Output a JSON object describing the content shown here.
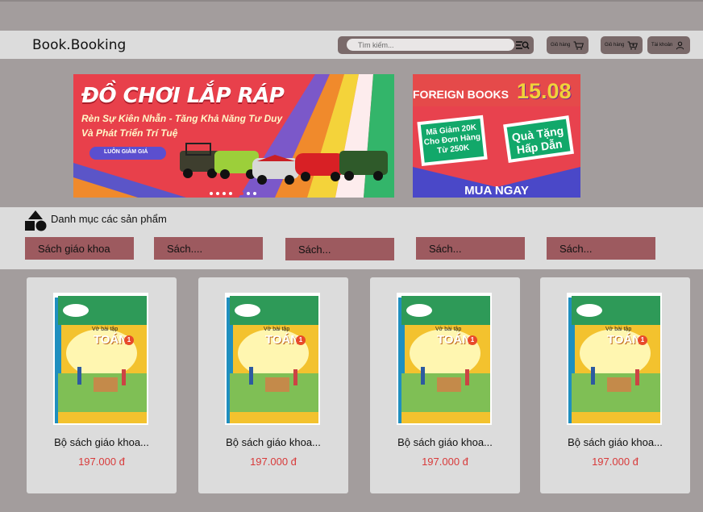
{
  "header": {
    "brand": "Book.Booking",
    "search_placeholder": "Tìm kiếm...",
    "orders_label_1": "Giỏ hàng",
    "orders_label_2": "Giỏ hàng",
    "account_label": "Tài khoản"
  },
  "banners": {
    "main": {
      "headline": "ĐỒ CHƠI LẮP RÁP",
      "line1": "Rèn Sự Kiên Nhẫn - Tăng Khả Năng Tư Duy",
      "line2": "Và Phát Triển Trí Tuệ",
      "badge": "LUÔN GIẢM GIÁ"
    },
    "side": {
      "title": "FOREIGN BOOKS",
      "date": "15.08",
      "coupon_l1": "Mã Giảm 20K",
      "coupon_l2": "Cho Đơn Hàng",
      "coupon_l3": "Từ 250K",
      "gift_l1": "Quà Tặng",
      "gift_l2": "Hấp Dẫn",
      "cta": "MUA NGAY"
    }
  },
  "categories": {
    "title": "Danh mục các sản phẩm",
    "items": [
      "Sách giáo khoa",
      "Sách....",
      "Sách...",
      "Sách...",
      "Sách..."
    ]
  },
  "products": [
    {
      "name": "Bộ sách giáo khoa...",
      "price": "197.000 đ",
      "cover_title": "TOÁN",
      "cover_sub": "Vở bài tập",
      "cover_grade": "1"
    },
    {
      "name": "Bộ sách giáo khoa...",
      "price": "197.000 đ",
      "cover_title": "TOÁN",
      "cover_sub": "Vở bài tập",
      "cover_grade": "1"
    },
    {
      "name": "Bộ sách giáo khoa...",
      "price": "197.000 đ",
      "cover_title": "TOÁN",
      "cover_sub": "Vở bài tập",
      "cover_grade": "1"
    },
    {
      "name": "Bộ sách giáo khoa...",
      "price": "197.000 đ",
      "cover_title": "TOÁN",
      "cover_sub": "Vở bài tập",
      "cover_grade": "1"
    }
  ],
  "colors": {
    "background": "#a39d9d",
    "bar": "#dcdcdc",
    "category_button": "#9d5a5f",
    "price": "#d83a3a",
    "banner_red": "#e8404b"
  }
}
